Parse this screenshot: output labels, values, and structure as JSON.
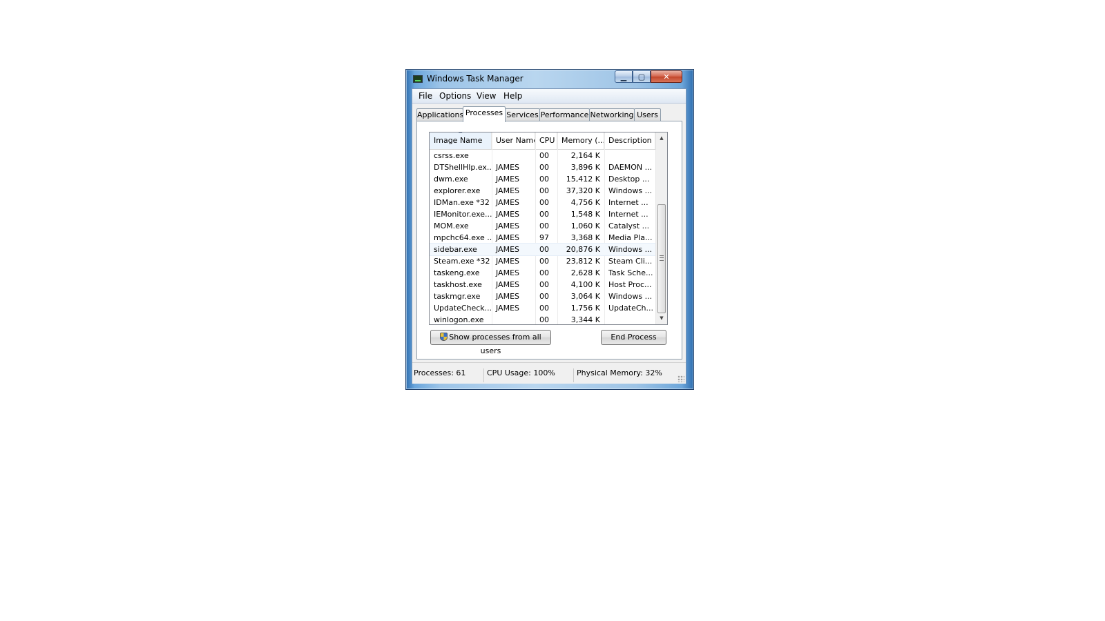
{
  "window": {
    "title": "Windows Task Manager",
    "controls": {
      "minimize": "▁",
      "maximize": "▢",
      "close": "✕"
    }
  },
  "menu": [
    "File",
    "Options",
    "View",
    "Help"
  ],
  "tabs": [
    "Applications",
    "Processes",
    "Services",
    "Performance",
    "Networking",
    "Users"
  ],
  "active_tab": "Processes",
  "table": {
    "columns": [
      "Image Name",
      "User Name",
      "CPU",
      "Memory (...",
      "Description"
    ],
    "sort_column": "Image Name",
    "rows": [
      [
        "csrss.exe",
        "",
        "00",
        "2,164 K",
        ""
      ],
      [
        "DTShellHlp.ex...",
        "JAMES",
        "00",
        "3,896 K",
        "DAEMON ..."
      ],
      [
        "dwm.exe",
        "JAMES",
        "00",
        "15,412 K",
        "Desktop ..."
      ],
      [
        "explorer.exe",
        "JAMES",
        "00",
        "37,320 K",
        "Windows ..."
      ],
      [
        "IDMan.exe *32",
        "JAMES",
        "00",
        "4,756 K",
        "Internet ..."
      ],
      [
        "IEMonitor.exe...",
        "JAMES",
        "00",
        "1,548 K",
        "Internet ..."
      ],
      [
        "MOM.exe",
        "JAMES",
        "00",
        "1,060 K",
        "Catalyst ..."
      ],
      [
        "mpchc64.exe ...",
        "JAMES",
        "97",
        "3,368 K",
        "Media Pla..."
      ],
      [
        "sidebar.exe",
        "JAMES",
        "00",
        "20,876 K",
        "Windows ..."
      ],
      [
        "Steam.exe *32",
        "JAMES",
        "00",
        "23,812 K",
        "Steam Cli..."
      ],
      [
        "taskeng.exe",
        "JAMES",
        "00",
        "2,628 K",
        "Task Sche..."
      ],
      [
        "taskhost.exe",
        "JAMES",
        "00",
        "4,100 K",
        "Host Proc..."
      ],
      [
        "taskmgr.exe",
        "JAMES",
        "00",
        "3,064 K",
        "Windows ..."
      ],
      [
        "UpdateCheck...",
        "JAMES",
        "00",
        "1,756 K",
        "UpdateCh..."
      ],
      [
        "winlogon.exe",
        "",
        "00",
        "3,344 K",
        ""
      ]
    ],
    "highlighted_row": 8
  },
  "buttons": {
    "show_all": "Show processes from all users",
    "end_process": "End Process"
  },
  "status": {
    "processes": "Processes: 61",
    "cpu": "CPU Usage: 100%",
    "memory": "Physical Memory: 32%"
  },
  "icons": {
    "app": "task-manager-icon",
    "uac": "uac-shield-icon"
  }
}
